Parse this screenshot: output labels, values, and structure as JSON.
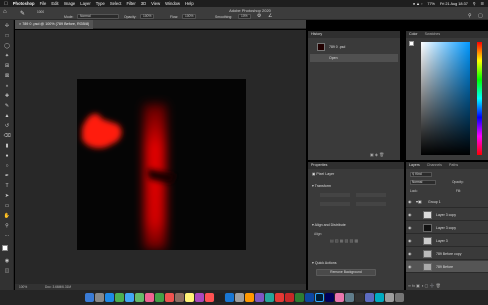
{
  "menubar": {
    "app_name": "Photoshop",
    "items": [
      "File",
      "Edit",
      "Image",
      "Layer",
      "Type",
      "Select",
      "Filter",
      "3D",
      "View",
      "Window",
      "Help"
    ],
    "battery": "77%",
    "clock": "Fri 21 Aug  18:37"
  },
  "window_title": "Adobe Photoshop 2020",
  "options": {
    "brush_size": "1000",
    "mode_label": "Mode:",
    "mode_value": "Normal",
    "opacity_label": "Opacity:",
    "opacity_value": "100%",
    "flow_label": "Flow:",
    "flow_value": "100%",
    "smoothing_label": "Smoothing:",
    "smoothing_value": "10%"
  },
  "document": {
    "tab_title": "789 0 .psd @ 100% (789 Before, RGB/8)",
    "zoom": "100%",
    "doc_info": "Doc: 3.66M/6.31M"
  },
  "history": {
    "title": "History",
    "snapshot": "789 0 .psd",
    "items": [
      "Open"
    ]
  },
  "color": {
    "tabs": [
      "Color",
      "Swatches"
    ]
  },
  "properties": {
    "title": "Properties",
    "kind": "Pixel Layer",
    "transform_label": "Transform",
    "align_label": "Align and Distribute",
    "align_sub": "Align:",
    "quick_actions_label": "Quick Actions",
    "remove_bg_label": "Remove Background"
  },
  "layers": {
    "tabs": [
      "Layers",
      "Channels",
      "Paths"
    ],
    "filter_label": "Kind",
    "blend_mode": "Normal",
    "opacity_label": "Opacity:",
    "lock_label": "Lock:",
    "fill_label": "Fill:",
    "rows": [
      {
        "name": "Group 1"
      },
      {
        "name": "Layer 3 copy"
      },
      {
        "name": "Layer 3 copy"
      },
      {
        "name": "Layer 3"
      },
      {
        "name": "789 Before copy"
      },
      {
        "name": "789 Before"
      }
    ]
  }
}
